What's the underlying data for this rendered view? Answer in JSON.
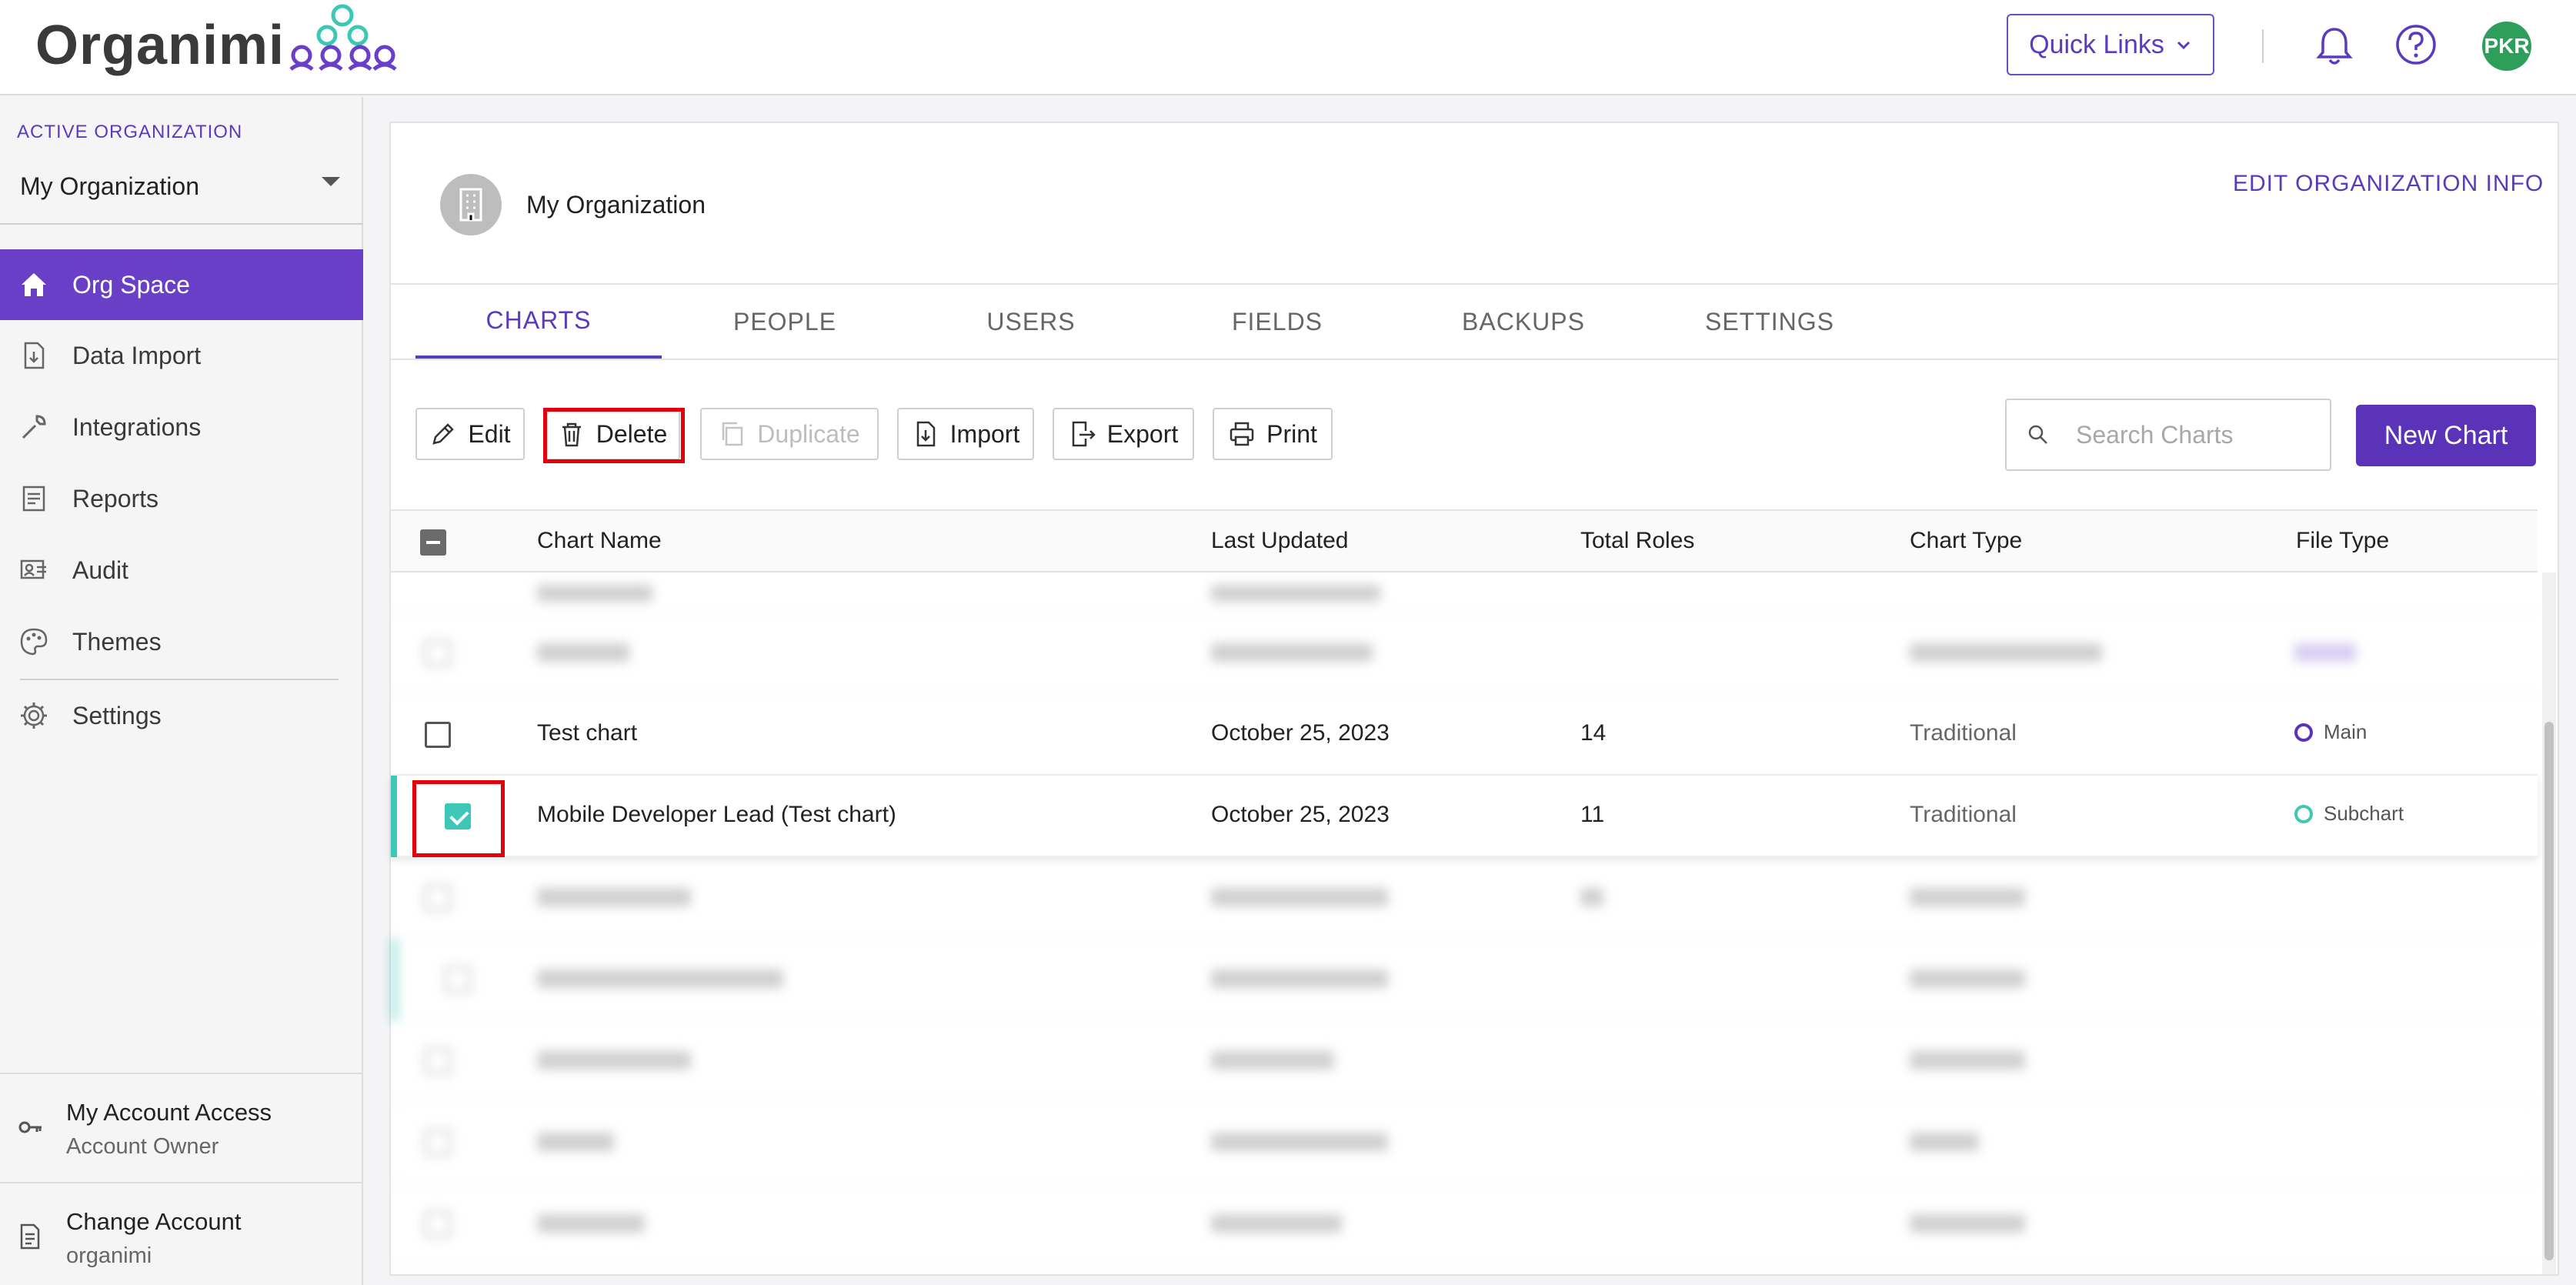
{
  "header": {
    "logo_text": "Organimi",
    "quick_links_label": "Quick Links",
    "avatar_initials": "PKR"
  },
  "sidebar": {
    "active_org_label": "ACTIVE ORGANIZATION",
    "active_org_value": "My Organization",
    "items": [
      {
        "label": "Org Space",
        "icon": "home-icon",
        "active": true
      },
      {
        "label": "Data Import",
        "icon": "file-import-icon"
      },
      {
        "label": "Integrations",
        "icon": "wrench-icon"
      },
      {
        "label": "Reports",
        "icon": "report-icon"
      },
      {
        "label": "Audit",
        "icon": "audit-icon"
      },
      {
        "label": "Themes",
        "icon": "palette-icon"
      },
      {
        "label": "Settings",
        "icon": "gear-icon"
      }
    ],
    "account_access": {
      "title": "My Account Access",
      "subtitle": "Account Owner"
    },
    "change_account": {
      "title": "Change Account",
      "subtitle": "organimi"
    }
  },
  "org": {
    "name": "My Organization",
    "edit_label": "EDIT ORGANIZATION INFO"
  },
  "tabs": [
    {
      "label": "CHARTS",
      "active": true
    },
    {
      "label": "PEOPLE"
    },
    {
      "label": "USERS"
    },
    {
      "label": "FIELDS"
    },
    {
      "label": "BACKUPS"
    },
    {
      "label": "SETTINGS"
    }
  ],
  "toolbar": {
    "edit": "Edit",
    "delete": "Delete",
    "duplicate": "Duplicate",
    "import": "Import",
    "export": "Export",
    "print": "Print",
    "search_placeholder": "Search Charts",
    "new_chart": "New Chart"
  },
  "table": {
    "columns": [
      "Chart Name",
      "Last Updated",
      "Total Roles",
      "Chart Type",
      "File Type"
    ],
    "rows": [
      {
        "name": "Test chart",
        "updated": "October 25, 2023",
        "roles": "14",
        "type": "Traditional",
        "file_type": "Main",
        "checked": false
      },
      {
        "name": "Mobile Developer Lead (Test chart)",
        "updated": "October 25, 2023",
        "roles": "11",
        "type": "Traditional",
        "file_type": "Subchart",
        "checked": true
      }
    ]
  },
  "colors": {
    "accent": "#5a33b8",
    "selected_accent": "#3cc7b6",
    "highlight": "#e3000b"
  }
}
